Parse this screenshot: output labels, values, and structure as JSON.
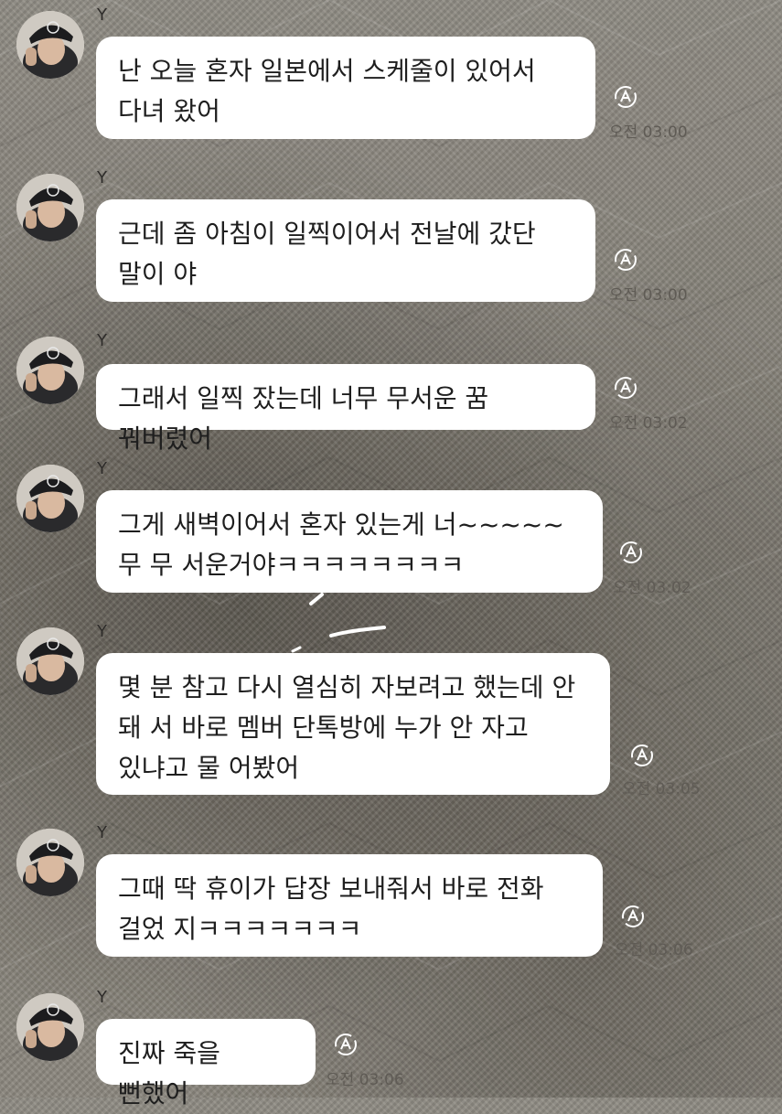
{
  "chat": {
    "sender_name": "Y",
    "messages": [
      {
        "text": "난 오늘 혼자 일본에서 스케줄이 있어서 다녀 왔어",
        "time": "오전 03:00"
      },
      {
        "text": "근데 좀 아침이 일찍이어서 전날에 갔단 말이 야",
        "time": "오전 03:00"
      },
      {
        "text": "그래서 일찍 잤는데 너무 무서운 꿈 꿔버렸어",
        "time": "오전 03:02"
      },
      {
        "text": "그게 새벽이어서 혼자 있는게 너~~~~~무 무 서운거야ㅋㅋㅋㅋㅋㅋㅋㅋ",
        "time": "오전 03:02"
      },
      {
        "text": "몇 분 참고 다시 열심히 자보려고 했는데 안 돼 서 바로 멤버 단톡방에 누가 안 자고 있냐고 물 어봤어",
        "time": "오전 03:05"
      },
      {
        "text": "그때 딱 휴이가 답장 보내줘서 바로 전화 걸었 지ㅋㅋㅋㅋㅋㅋㅋ",
        "time": "오전 03:06"
      },
      {
        "text": "진짜 죽을 뻔했어",
        "time": "오전 03:06"
      }
    ]
  },
  "icons": {
    "avatar": "profile-photo",
    "translate": "auto-translate-icon"
  },
  "colors": {
    "bubble": "#ffffff",
    "text": "#1e1e1e",
    "timestamp": "#5f5b55"
  }
}
